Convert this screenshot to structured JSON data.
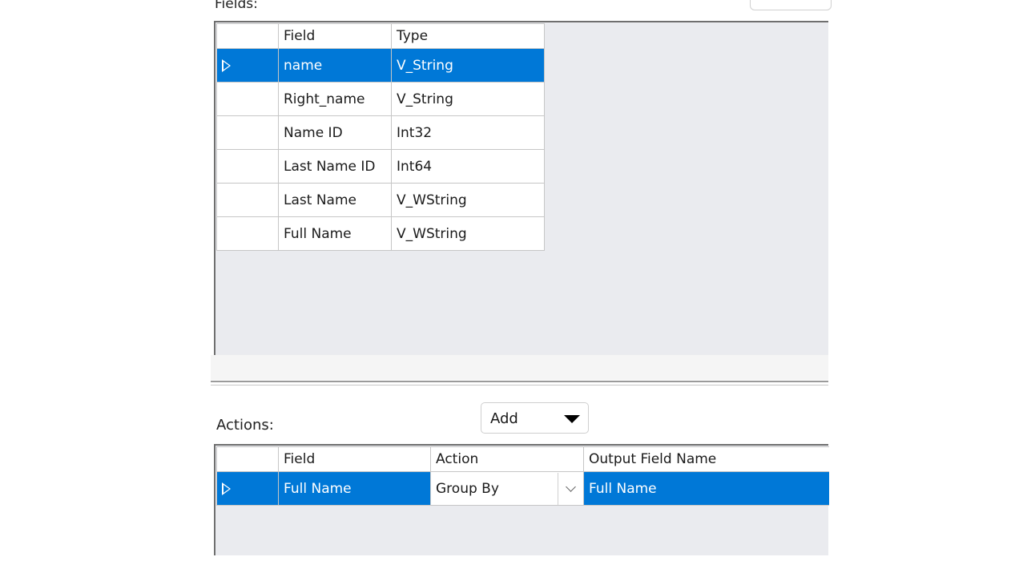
{
  "fields_section": {
    "label": "Fields:",
    "columns": [
      "Field",
      "Type"
    ],
    "rows": [
      {
        "field": "name",
        "type": "V_String",
        "selected": true
      },
      {
        "field": "Right_name",
        "type": "V_String"
      },
      {
        "field": "Name ID",
        "type": "Int32"
      },
      {
        "field": "Last Name ID",
        "type": "Int64"
      },
      {
        "field": "Last Name",
        "type": "V_WString"
      },
      {
        "field": "Full Name",
        "type": "V_WString"
      }
    ]
  },
  "actions_section": {
    "label": "Actions:",
    "add_button": "Add",
    "columns": [
      "Field",
      "Action",
      "Output Field Name"
    ],
    "rows": [
      {
        "field": "Full Name",
        "action": "Group By",
        "output_field_name": "Full Name",
        "selected": true
      }
    ]
  },
  "colors": {
    "selection": "#0078d7",
    "panel_bg": "#eaebef"
  },
  "icons": {
    "row_indicator": "triangle-right-icon",
    "dropdown": "chevron-down-icon",
    "add_caret": "caret-down-icon"
  }
}
